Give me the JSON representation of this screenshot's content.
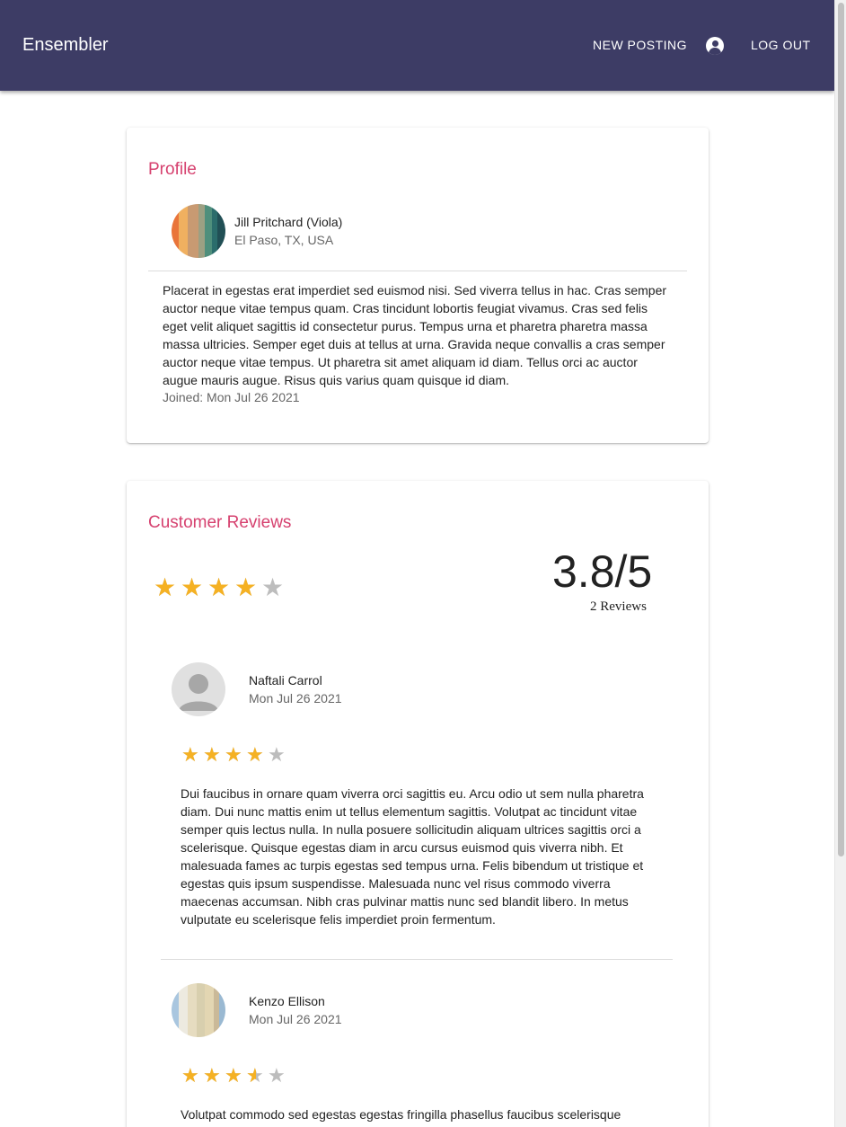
{
  "app": {
    "brand": "Ensembler",
    "nav": {
      "new_posting": "NEW POSTING",
      "log_out": "LOG OUT"
    }
  },
  "profile": {
    "title": "Profile",
    "name": "Jill Pritchard (Viola)",
    "location": "El Paso, TX, USA",
    "bio": "Placerat in egestas erat imperdiet sed euismod nisi. Sed viverra tellus in hac. Cras semper auctor neque vitae tempus quam. Cras tincidunt lobortis feugiat vivamus. Cras sed felis eget velit aliquet sagittis id consectetur purus. Tempus urna et pharetra pharetra massa massa ultricies. Semper eget duis at tellus at urna. Gravida neque convallis a cras semper auctor neque vitae tempus. Ut pharetra sit amet aliquam id diam. Tellus orci ac auctor augue mauris augue. Risus quis varius quam quisque id diam.",
    "joined": "Joined: Mon Jul 26 2021"
  },
  "reviews": {
    "title": "Customer Reviews",
    "average_rating": 3.8,
    "rating_text": "3.8/5",
    "count_text": "2 Reviews",
    "items": [
      {
        "name": "Naftali Carrol",
        "date": "Mon Jul 26 2021",
        "rating": 4,
        "text": "Dui faucibus in ornare quam viverra orci sagittis eu. Arcu odio ut sem nulla pharetra diam. Dui nunc mattis enim ut tellus elementum sagittis. Volutpat ac tincidunt vitae semper quis lectus nulla. In nulla posuere sollicitudin aliquam ultrices sagittis orci a scelerisque. Quisque egestas diam in arcu cursus euismod quis viverra nibh. Et malesuada fames ac turpis egestas sed tempus urna. Felis bibendum ut tristique et egestas quis ipsum suspendisse. Malesuada nunc vel risus commodo viverra maecenas accumsan. Nibh cras pulvinar mattis nunc sed blandit libero. In metus vulputate eu scelerisque felis imperdiet proin fermentum."
      },
      {
        "name": "Kenzo Ellison",
        "date": "Mon Jul 26 2021",
        "rating": 3.5,
        "text": "Volutpat commodo sed egestas egestas fringilla phasellus faucibus scelerisque"
      }
    ]
  },
  "colors": {
    "appbar": "#3d3c65",
    "accent": "#d6416f",
    "star_filled": "#f5b123",
    "star_empty": "#bdbdbd"
  },
  "icons": {
    "account": "account-circle-icon",
    "star": "star-icon",
    "default_avatar": "person-icon"
  }
}
